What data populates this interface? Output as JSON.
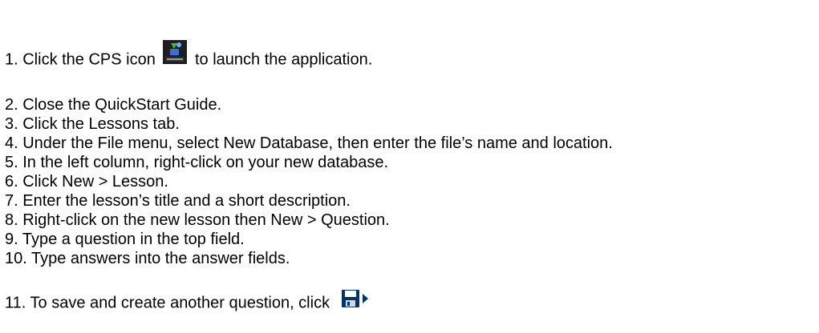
{
  "steps": [
    {
      "before": "1. Click the CPS icon ",
      "icon": "cps-app-icon",
      "after": " to launch the application."
    },
    {
      "text": "2. Close the QuickStart Guide."
    },
    {
      "text": "3. Click the Lessons tab."
    },
    {
      "text": "4. Under the File menu, select New Database, then enter the file’s name and location."
    },
    {
      "text": "5. In the left column, right-click on your new database."
    },
    {
      "text": "6. Click New  >  Lesson."
    },
    {
      "text": "7. Enter the lesson’s title and a short description."
    },
    {
      "text": "8. Right-click on the new lesson then New  >  Question."
    },
    {
      "text": "9. Type a question in the top field."
    },
    {
      "text": "10. Type answers into the answer fields."
    },
    {
      "before": "11. To save and create another question, click ",
      "icon": "save-next-icon"
    }
  ],
  "icons": {
    "cps_icon": {
      "name": "cps-app-icon",
      "caption": "CPS-RAX",
      "background": "#1e1e1e",
      "accent": "#4caf50"
    },
    "save_icon": {
      "name": "save-next-icon",
      "color": "#003366",
      "arrow_color": "#003366"
    }
  }
}
